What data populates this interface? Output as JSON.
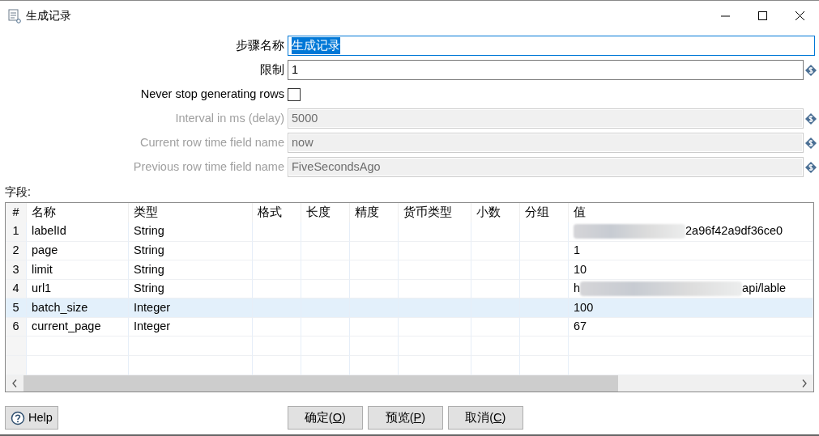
{
  "window": {
    "title": "生成记录"
  },
  "form": [
    {
      "kind": "text",
      "label": "步骤名称",
      "value": "生成记录",
      "focused": true,
      "disabled": false,
      "variable": false
    },
    {
      "kind": "text",
      "label": "限制",
      "value": "1",
      "focused": false,
      "disabled": false,
      "variable": true
    },
    {
      "kind": "checkbox",
      "label": "Never stop generating rows",
      "checked": false,
      "disabled": false
    },
    {
      "kind": "text",
      "label": "Interval in ms (delay)",
      "value": "5000",
      "focused": false,
      "disabled": true,
      "variable": true
    },
    {
      "kind": "text",
      "label": "Current row time field name",
      "value": "now",
      "focused": false,
      "disabled": true,
      "variable": true
    },
    {
      "kind": "text",
      "label": "Previous row time field name",
      "value": "FiveSecondsAgo",
      "focused": false,
      "disabled": true,
      "variable": true
    }
  ],
  "fields_label": "字段:",
  "table": {
    "columns": [
      "#",
      "名称",
      "类型",
      "格式",
      "长度",
      "精度",
      "货币类型",
      "小数",
      "分组",
      "值"
    ],
    "rows": [
      {
        "num": "1",
        "name": "labelId",
        "type": "String",
        "value": "2a96f42a9df36ce0",
        "redacted": true,
        "selected": false
      },
      {
        "num": "2",
        "name": "page",
        "type": "String",
        "value": "1",
        "redacted": false,
        "selected": false
      },
      {
        "num": "3",
        "name": "limit",
        "type": "String",
        "value": "10",
        "redacted": false,
        "selected": false
      },
      {
        "num": "4",
        "name": "url1",
        "type": "String",
        "value_prefix": "h",
        "value": "api/lable",
        "redacted": true,
        "selected": false
      },
      {
        "num": "5",
        "name": "batch_size",
        "type": "Integer",
        "value": "100",
        "redacted": false,
        "selected": true
      },
      {
        "num": "6",
        "name": "current_page",
        "type": "Integer",
        "value": "67",
        "redacted": false,
        "selected": false
      }
    ]
  },
  "help_button": "Help",
  "buttons": [
    {
      "before": "确定(",
      "key": "O",
      "after": ")"
    },
    {
      "before": "预览(",
      "key": "P",
      "after": ")"
    },
    {
      "before": "取消(",
      "key": "C",
      "after": ")"
    }
  ]
}
